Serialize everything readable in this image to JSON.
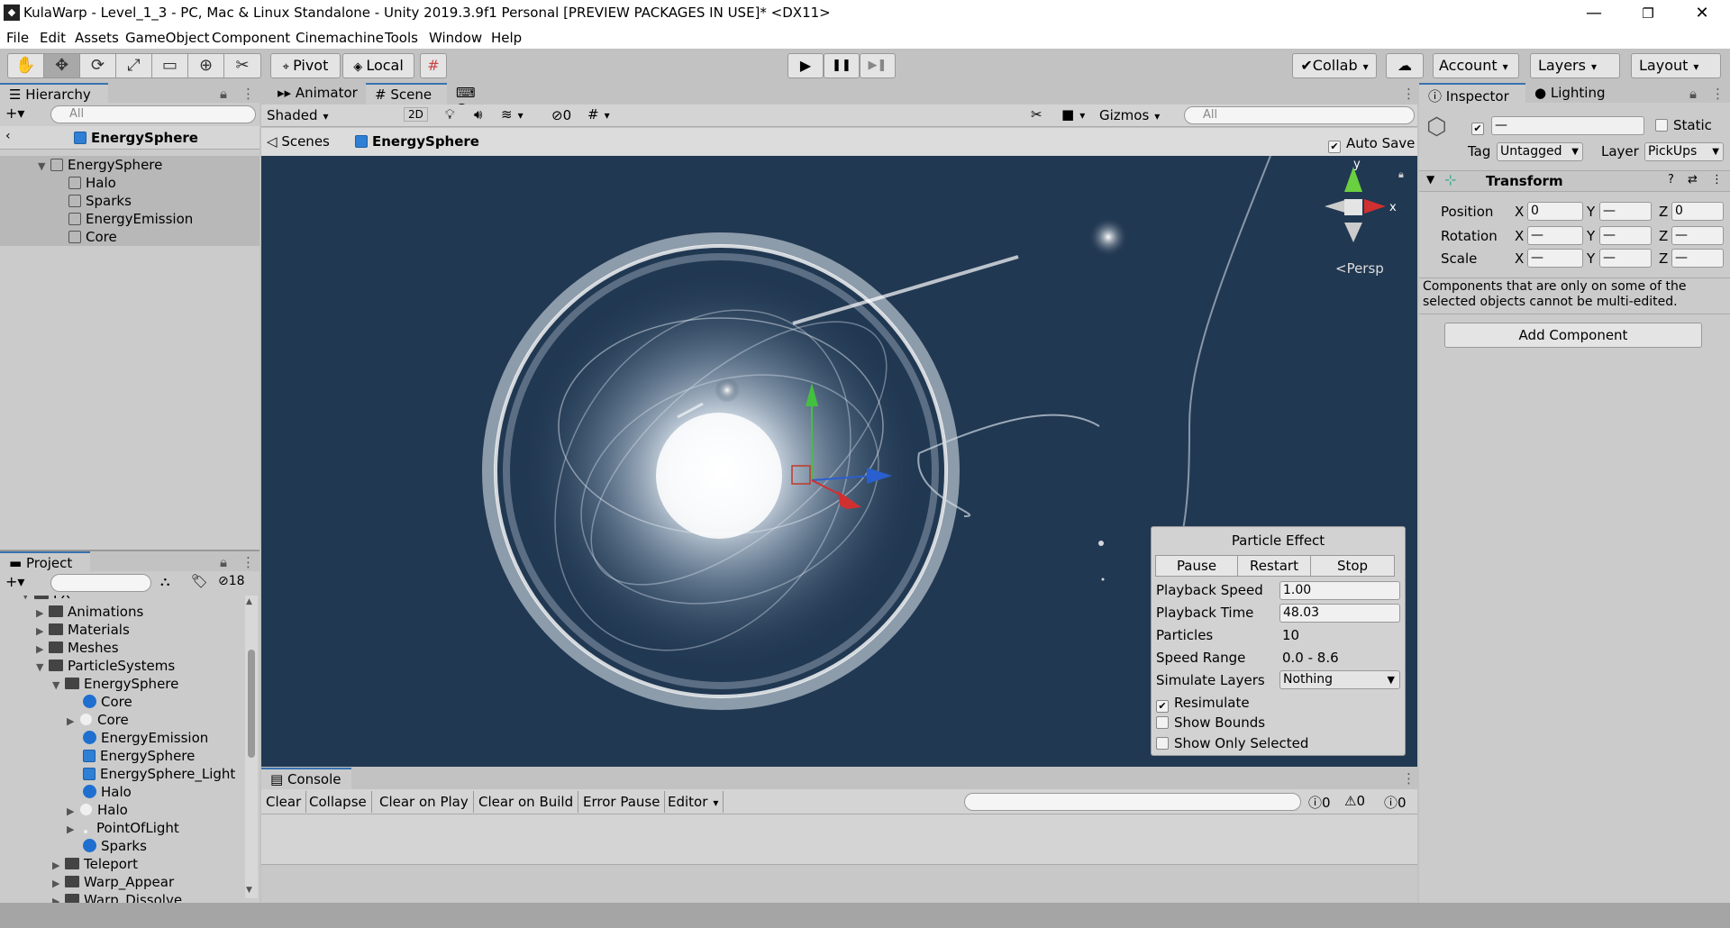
{
  "window": {
    "title": "KulaWarp - Level_1_3 - PC, Mac & Linux Standalone - Unity 2019.3.9f1 Personal [PREVIEW PACKAGES IN USE]* <DX11>",
    "app_icon": "unity-icon"
  },
  "menu": [
    "File",
    "Edit",
    "Assets",
    "GameObject",
    "Component",
    "Cinemachine",
    "Tools",
    "Window",
    "Help"
  ],
  "toolbar": {
    "tools": [
      "hand-icon",
      "move-icon",
      "rotate-icon",
      "scale-icon",
      "rect-icon",
      "transform-icon",
      "custom-tool-icon"
    ],
    "pivot": "Pivot",
    "local": "Local",
    "collab": "Collab",
    "account": "Account",
    "layers": "Layers",
    "layout": "Layout"
  },
  "hierarchy": {
    "tab": "Hierarchy",
    "search_placeholder": "All",
    "scene_title": "EnergySphere",
    "items": [
      {
        "label": "EnergySphere",
        "depth": 0
      },
      {
        "label": "Halo",
        "depth": 1
      },
      {
        "label": "Sparks",
        "depth": 1
      },
      {
        "label": "EnergyEmission",
        "depth": 1
      },
      {
        "label": "Core",
        "depth": 1
      }
    ]
  },
  "project": {
    "tab": "Project",
    "hidden_count": "18",
    "items": [
      {
        "label": "FX",
        "depth": 0,
        "kind": "folder"
      },
      {
        "label": "Animations",
        "depth": 1,
        "kind": "folder"
      },
      {
        "label": "Materials",
        "depth": 1,
        "kind": "folder"
      },
      {
        "label": "Meshes",
        "depth": 1,
        "kind": "folder"
      },
      {
        "label": "ParticleSystems",
        "depth": 1,
        "kind": "folder"
      },
      {
        "label": "EnergySphere",
        "depth": 2,
        "kind": "folder"
      },
      {
        "label": "Core",
        "depth": 3,
        "kind": "sphere"
      },
      {
        "label": "Core",
        "depth": 3,
        "kind": "white"
      },
      {
        "label": "EnergyEmission",
        "depth": 3,
        "kind": "sphere"
      },
      {
        "label": "EnergySphere",
        "depth": 3,
        "kind": "cube"
      },
      {
        "label": "EnergySphere_Light",
        "depth": 3,
        "kind": "cube"
      },
      {
        "label": "Halo",
        "depth": 3,
        "kind": "sphere"
      },
      {
        "label": "Halo",
        "depth": 3,
        "kind": "white"
      },
      {
        "label": "PointOfLight",
        "depth": 3,
        "kind": "white"
      },
      {
        "label": "Sparks",
        "depth": 3,
        "kind": "sphere"
      },
      {
        "label": "Teleport",
        "depth": 2,
        "kind": "folder"
      },
      {
        "label": "Warp_Appear",
        "depth": 2,
        "kind": "folder"
      },
      {
        "label": "Warp_Dissolve",
        "depth": 2,
        "kind": "folder"
      }
    ]
  },
  "scene": {
    "tabs": [
      "Animator",
      "Scene",
      "Game"
    ],
    "shading": "Shaded",
    "mode_2d": "2D",
    "hidden_count": "0",
    "gizmos": "Gizmos",
    "search_placeholder": "All",
    "breadcrumb_root": "Scenes",
    "breadcrumb_current": "EnergySphere",
    "auto_save": "Auto Save",
    "persp": "<Persp",
    "axis_y": "y",
    "axis_x": "x"
  },
  "particle_effect": {
    "title": "Particle Effect",
    "pause": "Pause",
    "restart": "Restart",
    "stop": "Stop",
    "rows": [
      {
        "label": "Playback Speed",
        "value": "1.00"
      },
      {
        "label": "Playback Time",
        "value": "48.03"
      },
      {
        "label": "Particles",
        "value": "10"
      },
      {
        "label": "Speed Range",
        "value": "0.0 - 8.6"
      },
      {
        "label": "Simulate Layers",
        "value": "Nothing"
      }
    ],
    "resimulate": "Resimulate",
    "show_bounds": "Show Bounds",
    "show_only_selected": "Show Only Selected"
  },
  "console": {
    "tab": "Console",
    "buttons": [
      "Clear",
      "Collapse",
      "Clear on Play",
      "Clear on Build",
      "Error Pause",
      "Editor"
    ],
    "info_count": "0",
    "warn_count": "0",
    "error_count": "0"
  },
  "inspector": {
    "tabs": [
      "Inspector",
      "Lighting"
    ],
    "name_value": "—",
    "static": "Static",
    "tag_label": "Tag",
    "tag": "Untagged",
    "layer_label": "Layer",
    "layer": "PickUps",
    "transform": "Transform",
    "position_label": "Position",
    "rotation_label": "Rotation",
    "scale_label": "Scale",
    "x_label": "X",
    "y_label": "Y",
    "z_label": "Z",
    "position": [
      "0",
      "—",
      "0"
    ],
    "rotation": [
      "—",
      "—",
      "—"
    ],
    "scale": [
      "—",
      "—",
      "—"
    ],
    "note": "Components that are only on some of the selected objects cannot be multi-edited.",
    "add_component": "Add Component"
  }
}
